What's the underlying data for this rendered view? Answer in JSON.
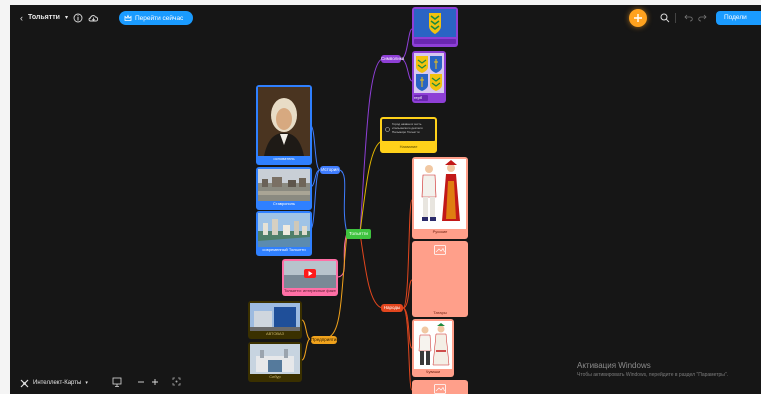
{
  "toolbar": {
    "map_title": "Тольятти",
    "go_now_label": "Перейти сейчас",
    "share_label": "Подели",
    "icons": [
      "back-arrow-icon",
      "chevron-down-icon",
      "info-icon",
      "cloud-icon",
      "crown-icon",
      "plus-icon",
      "search-icon",
      "undo-icon",
      "redo-icon"
    ]
  },
  "bottom_bar": {
    "mode_label": "Интеллект-Карты",
    "icons": [
      "mindmap-icon",
      "chevron-down-icon",
      "present-icon",
      "zoom-out-icon",
      "zoom-in-icon",
      "fit-screen-icon"
    ]
  },
  "nodes": {
    "center": "Тольятти",
    "symbols": "Символика",
    "symbols_sub": "герб",
    "history": "История",
    "history_portrait": "основатель",
    "history_old_city": "Ставрополь",
    "history_new_city": "современный Тольятти",
    "video_caption": "Тольятти: интересные факты",
    "industry": "Предприятия",
    "industry_avtovaz": "АВТОВАЗ",
    "industry_sibur": "Сибур",
    "note_text": "Город назван в честь итальянского деятеля Пальмиро Тольятти",
    "note_caption": "Название",
    "peoples": "Народы",
    "peoples_russians": "Русские",
    "peoples_tatars": "Татары",
    "peoples_chuvash": "Чуваши"
  },
  "watermark": {
    "title": "Активация Windows",
    "subtitle": "Чтобы активировать Windows, перейдите в раздел \"Параметры\"."
  },
  "colors": {
    "canvas": "#161616",
    "accent_blue": "#1a9bff",
    "orange_fab": "#ffa21f",
    "center_node": "#3fc33f",
    "symbols_branch": "#8e3fd6",
    "history_branch": "#3f7dff",
    "industry_branch": "#f0a21c",
    "peoples_branch": "#e2461e",
    "video_card": "#ff6fa6",
    "note_card": "#ffd11a",
    "peoples_card": "#ff9f8a"
  }
}
